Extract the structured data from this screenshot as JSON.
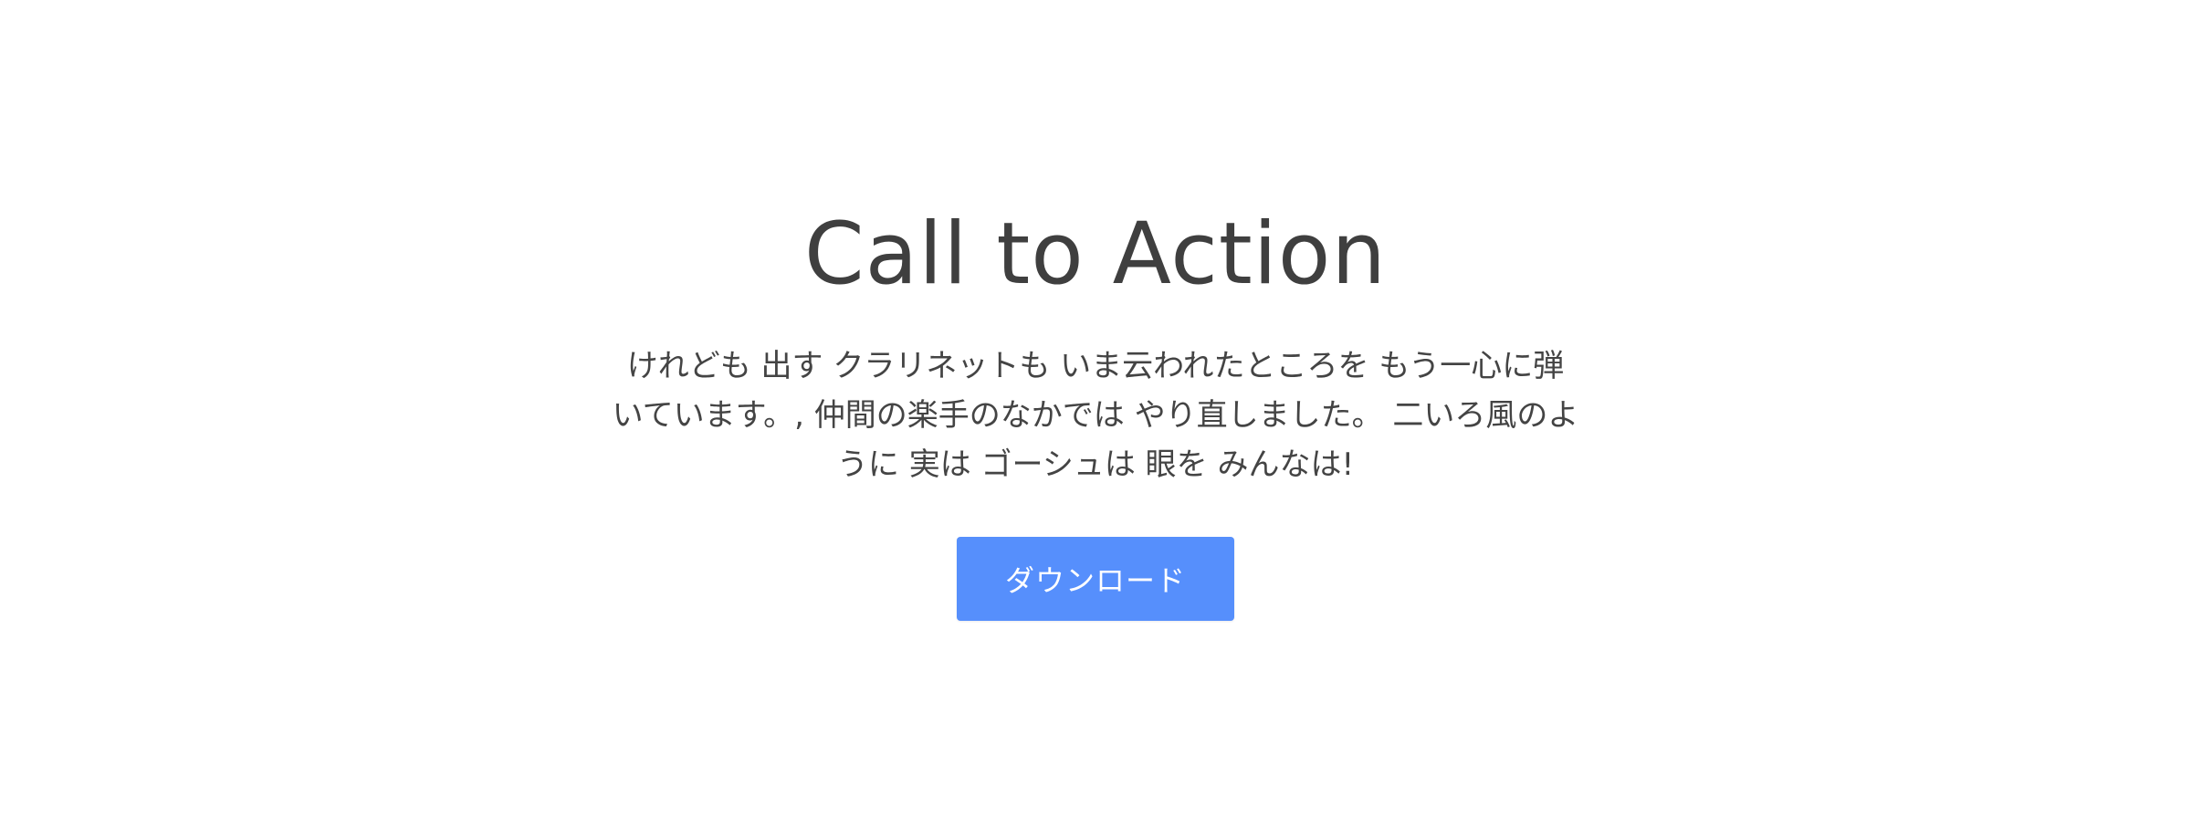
{
  "cta": {
    "title": "Call to Action",
    "text": "けれども 出す クラリネットも いま云われたところを もう一心に弾いています。, 仲間の楽手のなかでは やり直しました。 二いろ風のように 実は ゴーシュは 眼を みんなは!",
    "button_label": "ダウンロード"
  },
  "colors": {
    "background": "#ffffff",
    "text": "#3f3f3f",
    "button_bg": "#568ffc",
    "button_text": "#ffffff"
  }
}
